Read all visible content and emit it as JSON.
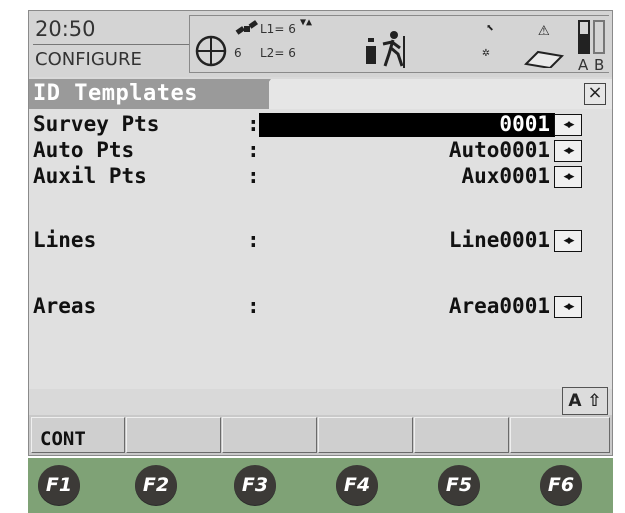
{
  "status": {
    "time": "20:50",
    "mode": "CONFIGURE",
    "icons": {
      "position": "crosshair-icon",
      "satellite": "satellite-icon",
      "satellites_count": "6",
      "l1": "L1= 6",
      "l2": "L2= 6",
      "reflector": "reflector-icon",
      "user": "walking-person-icon",
      "link": "link-icon",
      "compass": "warning-icon",
      "memory": "memory-card-icon",
      "battery": "battery-icon",
      "batteries": [
        "A",
        "B"
      ]
    }
  },
  "dialog": {
    "title": "ID Templates",
    "close_icon": "close-icon"
  },
  "fields": [
    {
      "label": "Survey Pts",
      "colon": ":",
      "value": "0001",
      "selected": true
    },
    {
      "label": "Auto Pts",
      "colon": ":",
      "value": "Auto0001",
      "selected": false
    },
    {
      "label": "Auxil Pts",
      "colon": ":",
      "value": "Aux0001",
      "selected": false
    },
    {
      "label": "Lines",
      "colon": ":",
      "value": "Line0001",
      "selected": false
    },
    {
      "label": "Areas",
      "colon": ":",
      "value": "Area0001",
      "selected": false
    }
  ],
  "spinner_glyph": "◂▸",
  "input_mode": "A ⇧",
  "softkeys": [
    "CONT",
    "",
    "",
    "",
    "",
    ""
  ],
  "fkeys": [
    "F1",
    "F2",
    "F3",
    "F4",
    "F5",
    "F6"
  ]
}
